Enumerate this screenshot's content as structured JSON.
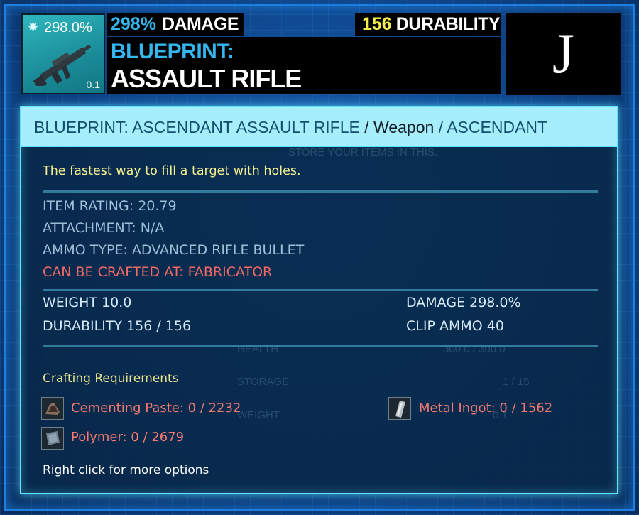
{
  "header": {
    "thumb_percent": "298.0%",
    "thumb_quantity": "0.1",
    "damage_value": "298%",
    "damage_label": "DAMAGE",
    "durability_value": "156",
    "durability_label": "DURABILITY",
    "title_line1": "BLUEPRINT:",
    "title_line2": "ASSAULT RIFLE",
    "hotkey": "J"
  },
  "tooltip": {
    "name": "BLUEPRINT: ASCENDANT ASSAULT RIFLE",
    "sep1": " / ",
    "category": "Weapon",
    "sep2": " / ",
    "quality": "ASCENDANT",
    "description": "The fastest way to fill a target with holes.",
    "item_rating": "ITEM RATING: 20.79",
    "attachment": "ATTACHMENT: N/A",
    "ammo_type": "AMMO TYPE: ADVANCED RIFLE BULLET",
    "crafted_at": "CAN BE CRAFTED AT: FABRICATOR",
    "weight": "WEIGHT 10.0",
    "damage": "DAMAGE 298.0%",
    "durability": "DURABILITY 156 / 156",
    "clip_ammo": "CLIP AMMO 40",
    "crafting_header": "Crafting Requirements",
    "requirements": [
      {
        "name": "Cementing Paste: 0 / 2232",
        "icon": "cementing-paste-icon"
      },
      {
        "name": "Metal Ingot: 0 / 1562",
        "icon": "metal-ingot-icon"
      },
      {
        "name": "Polymer: 0 / 2679",
        "icon": "polymer-icon"
      }
    ],
    "hint": "Right click for more options"
  },
  "background_text": {
    "store": "STORE YOUR ITEMS IN THIS.",
    "health": "HEALTH",
    "health_value": "300.0 / 300.0",
    "storage": "STORAGE",
    "storage_value": "1 / 15",
    "weight": "WEIGHT",
    "weight_value": "0.1"
  },
  "colors": {
    "accent_blue": "#34b6ee",
    "durability_yellow": "#f5ef4a",
    "tooltip_border": "#5fe3ff",
    "requirement_red": "#f27a70",
    "crafted_at_red": "#f26a66"
  }
}
